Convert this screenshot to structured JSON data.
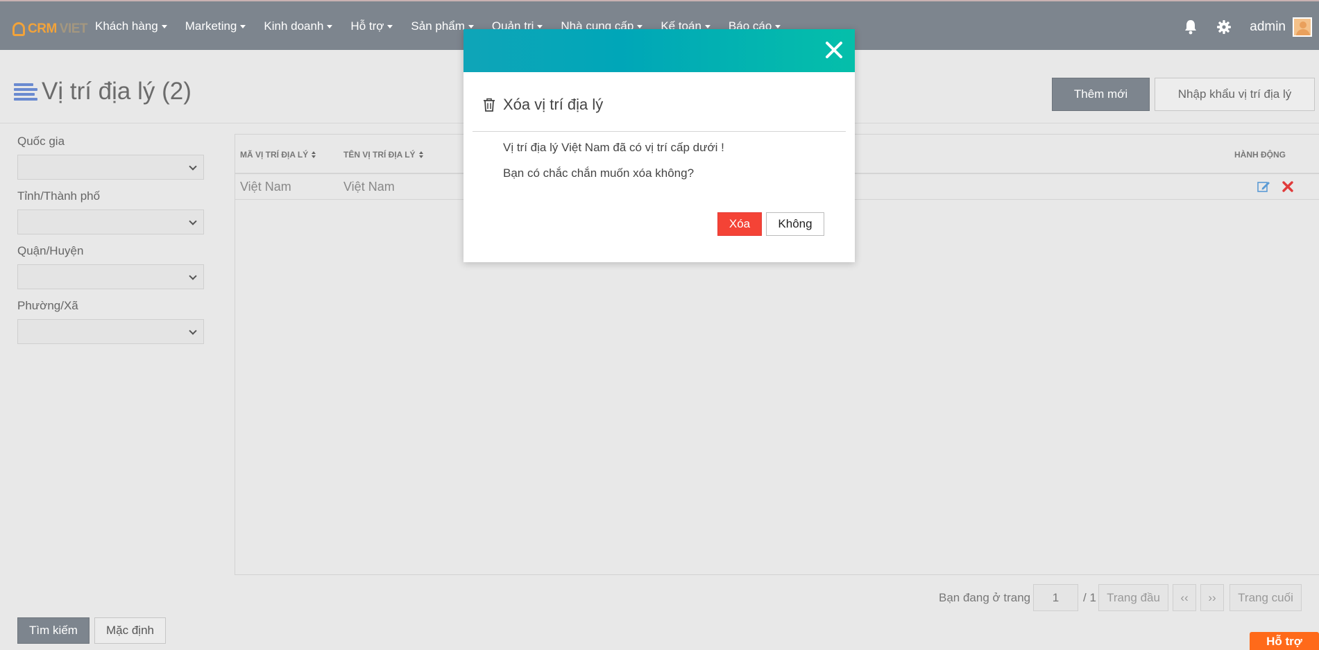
{
  "navbar": {
    "logo": {
      "primary": "CRM",
      "secondary": "VIET"
    },
    "menu": [
      {
        "label": "Khách hàng"
      },
      {
        "label": "Marketing"
      },
      {
        "label": "Kinh doanh"
      },
      {
        "label": "Hỗ trợ"
      },
      {
        "label": "Sản phẩm"
      },
      {
        "label": "Quản trị"
      },
      {
        "label": "Nhà cung cấp"
      },
      {
        "label": "Kế toán"
      },
      {
        "label": "Báo cáo"
      }
    ],
    "user": "admin"
  },
  "page": {
    "title": "Vị trí địa lý (2)",
    "add_button": "Thêm mới",
    "import_button": "Nhập khẩu vị trí địa lý"
  },
  "filters": {
    "items": [
      {
        "label": "Quốc gia",
        "value": ""
      },
      {
        "label": "Tỉnh/Thành phố",
        "value": ""
      },
      {
        "label": "Quận/Huyện",
        "value": ""
      },
      {
        "label": "Phường/Xã",
        "value": ""
      }
    ],
    "search_button": "Tìm kiếm",
    "default_button": "Mặc định"
  },
  "table": {
    "columns": [
      "MÃ VỊ TRÍ ĐỊA LÝ",
      "TÊN VỊ TRÍ ĐỊA LÝ",
      "HÀNH ĐỘNG"
    ],
    "rows": [
      {
        "code": "Việt Nam",
        "name": "Việt Nam"
      }
    ]
  },
  "pagination": {
    "label": "Bạn đang ở trang",
    "current": "1",
    "total": "/ 1",
    "first": "Trang đầu",
    "prev": "‹‹",
    "next": "››",
    "last": "Trang cuối"
  },
  "support_tab": "Hỗ trợ",
  "modal": {
    "title": "Xóa vị trí địa lý",
    "message1": "Vị trí địa lý Việt Nam đã có vị trí cấp dưới !",
    "message2": "Bạn có chắc chắn muốn xóa không?",
    "confirm": "Xóa",
    "cancel": "Không"
  },
  "colors": {
    "navbar": "#7d858e",
    "accent_logo": "#f2a33a",
    "modal_header": "#00a6b8",
    "danger": "#f44336",
    "support": "#ff6a1a"
  }
}
